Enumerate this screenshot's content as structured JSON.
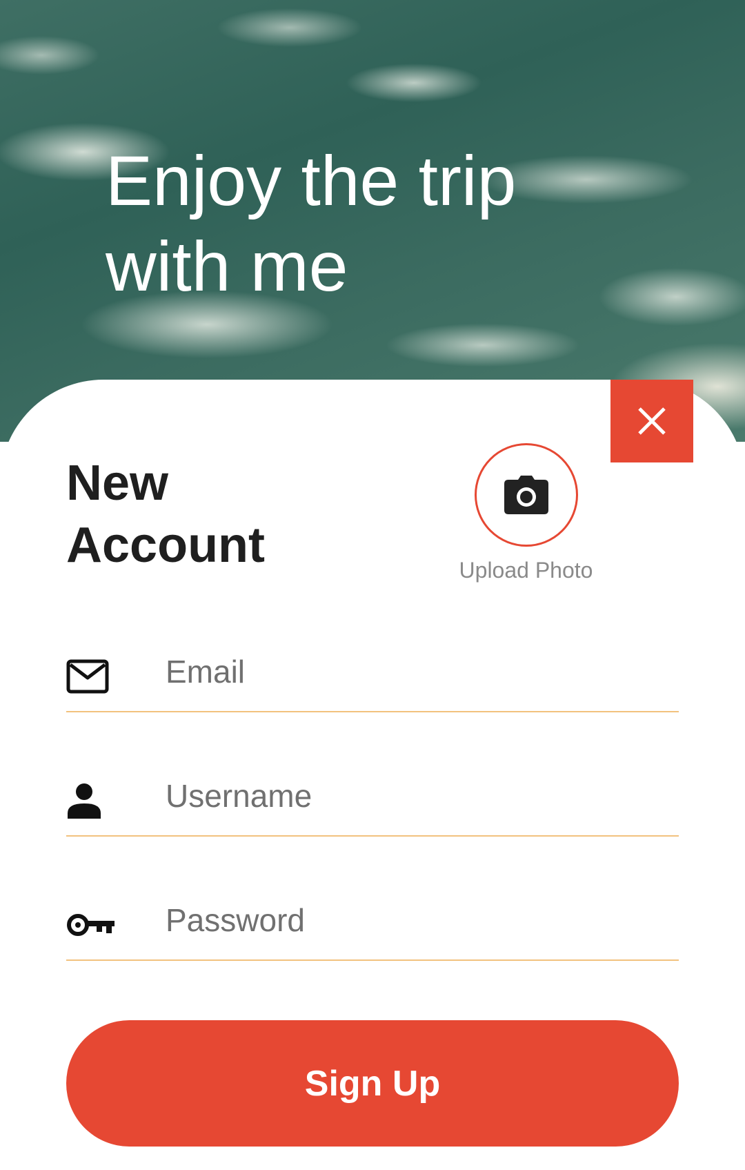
{
  "hero": {
    "title_line1": "Enjoy the trip",
    "title_line2": "with me"
  },
  "card": {
    "title_line1": "New",
    "title_line2": "Account",
    "upload_label": "Upload Photo"
  },
  "form": {
    "email_placeholder": "Email",
    "username_placeholder": "Username",
    "password_placeholder": "Password",
    "signup_label": "Sign Up"
  },
  "icons": {
    "close": "close-icon",
    "camera": "camera-icon",
    "email": "email-icon",
    "user": "person-icon",
    "password": "key-icon"
  },
  "colors": {
    "accent": "#e64833",
    "underline": "#f2c27e",
    "title": "#1f1f1f",
    "muted": "#8a8a8a"
  }
}
